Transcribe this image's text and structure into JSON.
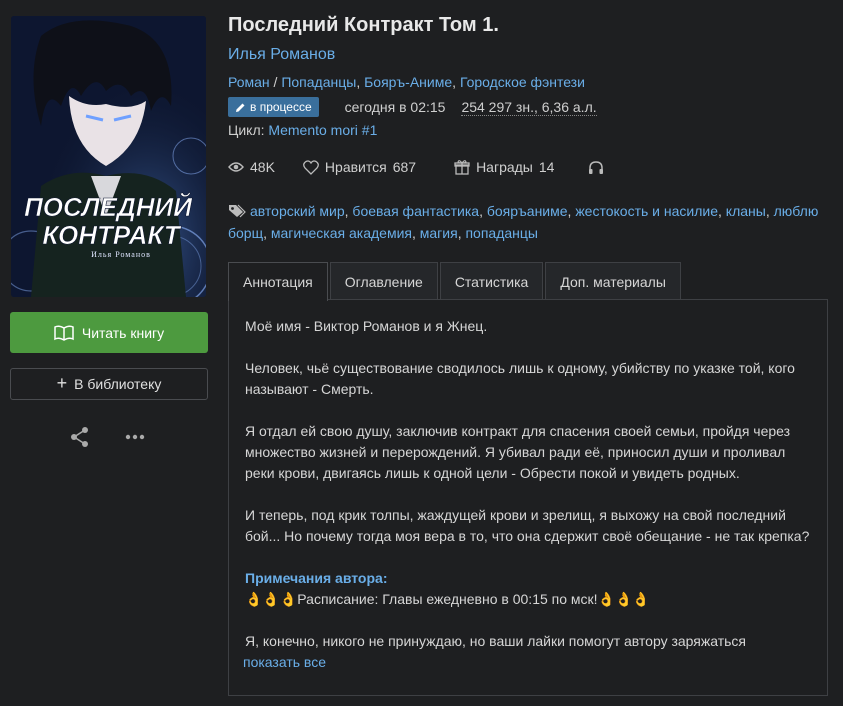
{
  "book": {
    "title": "Последний Контракт Том 1.",
    "author": "Илья Романов",
    "genres": [
      "Роман",
      "Попаданцы",
      "Бояръ-Аниме",
      "Городское фэнтези"
    ],
    "status": "в процессе",
    "updated": "сегодня в 02:15",
    "size": "254 297 зн., 6,36 а.л.",
    "cycle_label": "Цикл:",
    "cycle_name": "Memento mori #1"
  },
  "cover": {
    "title_line1": "ПОСЛЕДНИЙ",
    "title_line2": "КОНТРАКТ",
    "author_line": "Илья Романов"
  },
  "stats": {
    "views": "48K",
    "likes_label": "Нравится",
    "likes": "687",
    "awards_label": "Награды",
    "awards": "14"
  },
  "tags": [
    "авторский мир",
    "боевая фантастика",
    "бояръаниме",
    "жестокость и насилие",
    "кланы",
    "люблю борщ",
    "магическая академия",
    "магия",
    "попаданцы"
  ],
  "actions": {
    "read_label": "Читать книгу",
    "library_label": "В библиотеку"
  },
  "tabs": [
    "Аннотация",
    "Оглавление",
    "Статистика",
    "Доп. материалы"
  ],
  "annotation": {
    "paragraphs": [
      "Моё имя - Виктор Романов и я Жнец.",
      "Человек, чьё существование сводилось лишь к одному, убийству по указке той, кого называют - Смерть.",
      "Я отдал ей свою душу, заключив контракт для спасения своей семьи, пройдя через множество жизней и перерождений. Я убивал ради её, приносил души и проливал реки крови, двигаясь лишь к одной цели - Обрести покой и увидеть родных.",
      "И теперь, под крик толпы, жаждущей крови и зрелищ, я выхожу на свой последний бой... Но почему тогда моя вера в то, что она сдержит своё обещание - не так крепка?"
    ],
    "notes_title": "Примечания автора:",
    "schedule_prefix": "👌👌👌",
    "schedule": "Расписание: Главы ежедневно в 00:15 по мск!",
    "schedule_suffix": "👌👌👌",
    "last_line": "Я, конечно, никого не принуждаю, но ваши лайки помогут автору заряжаться",
    "show_all": "показать все"
  },
  "colors": {
    "background": "#1e1f21",
    "link": "#6aaee8",
    "read_button": "#4d9a3f",
    "status_badge": "#3a6f9c"
  }
}
